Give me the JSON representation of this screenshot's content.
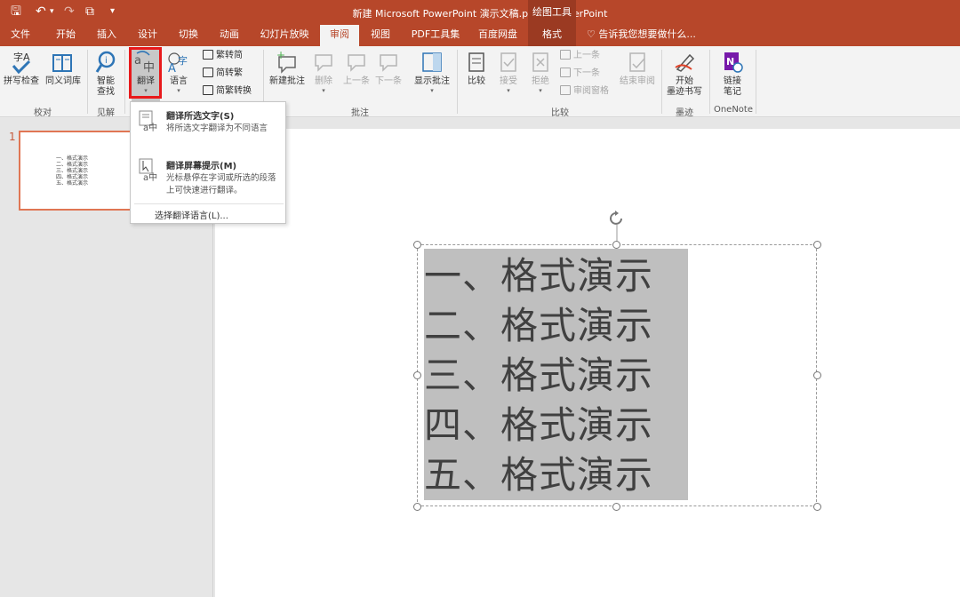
{
  "window": {
    "title": "新建 Microsoft PowerPoint 演示文稿.pptx - PowerPoint",
    "context_header": "绘图工具"
  },
  "qat": {
    "save": "🖫",
    "undo": "↶",
    "undo_caret": "▾",
    "redo": "↷",
    "present": "⧉",
    "customize": "▾"
  },
  "tabs": [
    {
      "label": "文件"
    },
    {
      "label": "开始"
    },
    {
      "label": "插入"
    },
    {
      "label": "设计"
    },
    {
      "label": "切换"
    },
    {
      "label": "动画"
    },
    {
      "label": "幻灯片放映"
    },
    {
      "label": "审阅"
    },
    {
      "label": "视图"
    },
    {
      "label": "PDF工具集"
    },
    {
      "label": "百度网盘"
    },
    {
      "label": "格式"
    }
  ],
  "tellme": "告诉我您想要做什么...",
  "ribbon": {
    "proofing": {
      "spell": "拼写检查",
      "thesaurus": "同义词库",
      "group": "校对"
    },
    "insights": {
      "smart": "智能\n查找",
      "smart_1": "智能",
      "smart_2": "查找",
      "group": "见解"
    },
    "language": {
      "translate": "翻译",
      "language": "语言",
      "trad_to_simp": "繁转简",
      "simp_to_trad": "简转繁",
      "convert": "简繁转换"
    },
    "comments": {
      "new": "新建批注",
      "delete": "删除",
      "prev": "上一条",
      "next": "下一条",
      "show": "显示批注",
      "group": "批注"
    },
    "compare": {
      "compare": "比较",
      "accept": "接受",
      "reject": "拒绝",
      "prev": "上一条",
      "next": "下一条",
      "pane": "审阅窗格",
      "end": "结束审阅",
      "group": "比较"
    },
    "ink": {
      "start_1": "开始",
      "start_2": "墨迹书写",
      "group": "墨迹"
    },
    "onenote": {
      "link_1": "链接",
      "link_2": "笔记",
      "group": "OneNote"
    }
  },
  "dropdown": {
    "item1_title": "翻译所选文字(S)",
    "item1_desc": "将所选文字翻译为不同语言",
    "item2_title": "翻译屏幕提示(M)",
    "item2_desc": "光标悬停在字词或所选的段落上可快速进行翻译。",
    "footer": "选择翻译语言(L)..."
  },
  "thumbnail": {
    "number": "1"
  },
  "slide": {
    "lines": [
      "一、格式演示",
      "二、格式演示",
      "三、格式演示",
      "四、格式演示",
      "五、格式演示"
    ]
  },
  "colors": {
    "accent": "#b7472a",
    "highlight": "#e8191b",
    "selection": "#bfbfbf"
  }
}
